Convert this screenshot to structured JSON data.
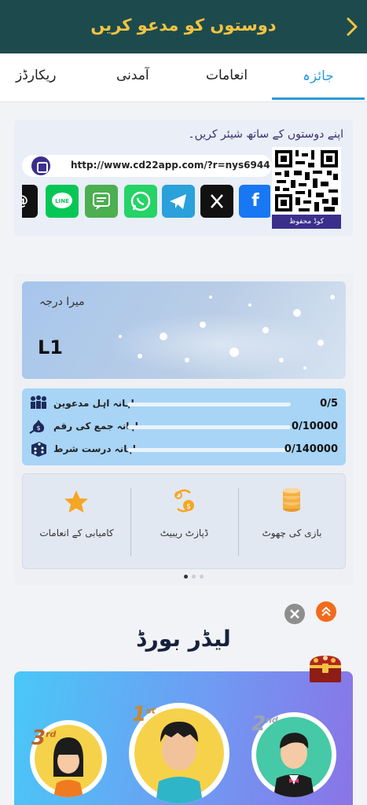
{
  "header": {
    "title": "دوستوں کو مدعو کریں",
    "back_icon": "chevron-right-icon"
  },
  "tabs": [
    {
      "label": "جائزہ",
      "active": true
    },
    {
      "label": "انعامات",
      "active": false
    },
    {
      "label": "آمدنی",
      "active": false
    },
    {
      "label": "ریکارڈز",
      "active": false
    }
  ],
  "invite": {
    "text": "اپنے دوستوں کے ساتھ شیئر کریں۔",
    "link": "http://www.cd22app.com/?r=nys6944",
    "qr_label": "کوڈ محفوظ",
    "share_icons": [
      "threads-icon",
      "line-icon",
      "sms-icon",
      "whatsapp-icon",
      "telegram-icon",
      "x-icon",
      "facebook-icon"
    ]
  },
  "level": {
    "title": "میرا درجہ",
    "value": "L1"
  },
  "stats": [
    {
      "label": "ماہانہ اہل مدعوین",
      "value": "0/5",
      "progress": 0,
      "icon": "people-icon"
    },
    {
      "label": "ماہانہ جمع کی رقم",
      "value": "0/10000",
      "progress": 0,
      "icon": "money-bag-icon"
    },
    {
      "label": "ماہانہ درست شرط",
      "value": "0/140000",
      "progress": 0,
      "icon": "dice-icon"
    }
  ],
  "features": [
    {
      "label": "کامیابی کے انعامات",
      "icon": "star-icon"
    },
    {
      "label": "ڈپازٹ ریبیٹ",
      "icon": "rebate-icon"
    },
    {
      "label": "بازی کی چھوٹ",
      "icon": "coins-icon"
    }
  ],
  "leaderboard": {
    "title": "لیڈر بورڈ",
    "ranks": [
      {
        "place": "1",
        "suffix": "st"
      },
      {
        "place": "2",
        "suffix": "nd"
      },
      {
        "place": "3",
        "suffix": "rd"
      }
    ]
  },
  "colors": {
    "header_bg": "#1d4b4d",
    "accent": "#2d9bd8",
    "gold": "#f3c340",
    "purple": "#3b2f8c"
  }
}
